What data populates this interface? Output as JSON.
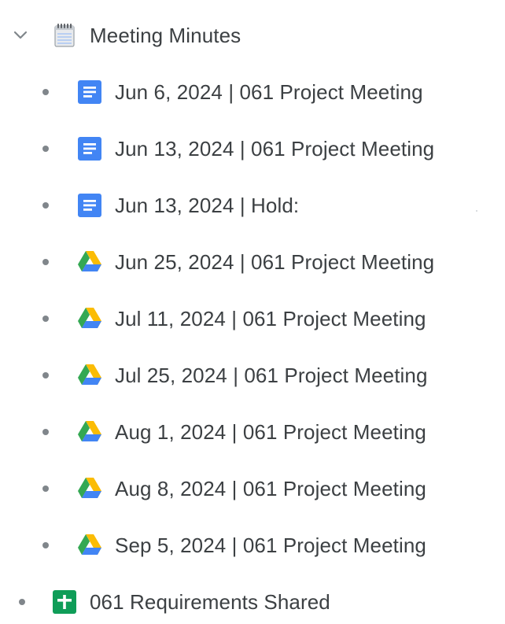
{
  "folder": {
    "label": "Meeting Minutes",
    "icon": "notepad-icon",
    "expanded": true
  },
  "children": [
    {
      "label": "Jun 6, 2024 | 061 Project Meeting",
      "icon": "google-docs-icon"
    },
    {
      "label": "Jun 13, 2024 | 061 Project Meeting",
      "icon": "google-docs-icon"
    },
    {
      "label": "Jun 13, 2024 | Hold:",
      "icon": "google-docs-icon"
    },
    {
      "label": "Jun 25, 2024 | 061 Project Meeting",
      "icon": "google-drive-icon"
    },
    {
      "label": "Jul 11, 2024 | 061 Project Meeting",
      "icon": "google-drive-icon"
    },
    {
      "label": "Jul 25, 2024 | 061 Project Meeting",
      "icon": "google-drive-icon"
    },
    {
      "label": "Aug 1, 2024 | 061 Project Meeting",
      "icon": "google-drive-icon"
    },
    {
      "label": "Aug 8, 2024 | 061 Project Meeting",
      "icon": "google-drive-icon"
    },
    {
      "label": "Sep 5, 2024 | 061 Project Meeting",
      "icon": "google-drive-icon"
    }
  ],
  "sibling": {
    "label": "061 Requirements Shared",
    "icon": "google-sheets-icon"
  },
  "colors": {
    "text": "#3c4043",
    "bullet": "#80868b",
    "docs_blue": "#4285f4",
    "sheets_green": "#0f9d58",
    "drive_yellow": "#fbbc04",
    "drive_green": "#34a853",
    "drive_blue": "#4285f4"
  }
}
